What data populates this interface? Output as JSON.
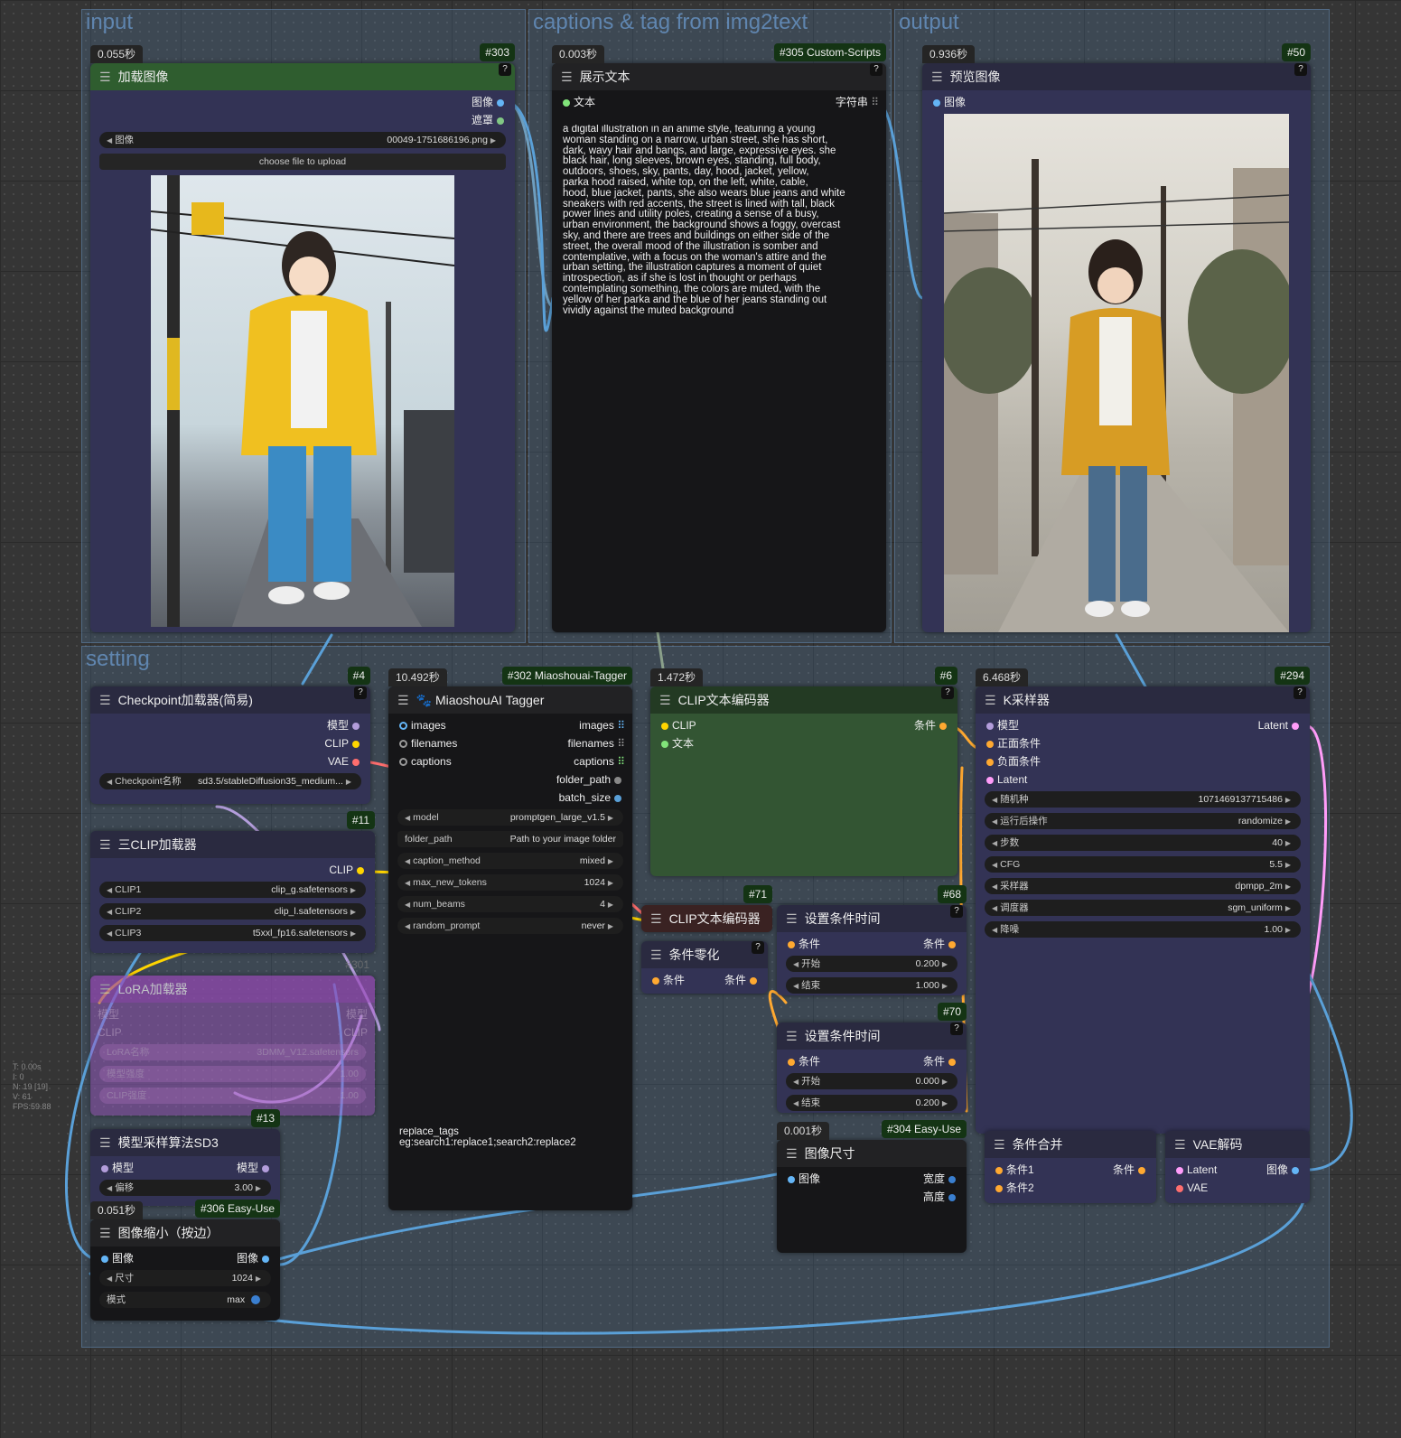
{
  "groups": {
    "input": "input",
    "captions": "captions & tag from img2text",
    "output": "output",
    "setting": "setting"
  },
  "nodes": {
    "load_image": {
      "time": "0.055秒",
      "id": "#303",
      "title": "加载图像",
      "outputs": [
        "图像",
        "遮罩"
      ],
      "image_widget_label": "图像",
      "image_widget_value": "00049-1751686196.png",
      "upload_label": "choose file to upload"
    },
    "show_text": {
      "time": "0.003秒",
      "id": "#305 Custom-Scripts",
      "title": "展示文本",
      "input": "文本",
      "output": "字符串",
      "lines": [
        "a digital illustration in an anime style, featuring a young",
        "woman standing on a narrow, urban street, she has short,",
        "dark, wavy hair and bangs, and large, expressive eyes. she",
        "black hair, long sleeves, brown eyes, standing, full body,",
        "outdoors, shoes, sky, pants, day, hood, jacket, yellow,",
        "parka hood raised, white top, on the left, white, cable,",
        "hood, blue jacket, pants, she also wears blue jeans and white",
        "sneakers with red accents, the street is lined with tall, black",
        "power lines and utility poles, creating a sense of a busy,",
        "urban environment, the background shows a foggy, overcast",
        "sky, and there are trees and buildings on either side of the",
        "street, the overall mood of the illustration is somber and",
        "contemplative, with a focus on the woman's attire and the",
        "urban setting, the illustration captures a moment of quiet",
        "introspection, as if she is lost in thought or perhaps",
        "contemplating something, the colors are muted, with the",
        "yellow of her parka and the blue of her jeans standing out",
        "vividly against the muted background"
      ]
    },
    "preview": {
      "time": "0.936秒",
      "id": "#50",
      "title": "预览图像",
      "input": "图像"
    },
    "checkpoint": {
      "id": "#4",
      "title": "Checkpoint加载器(简易)",
      "outputs": [
        "模型",
        "CLIP",
        "VAE"
      ],
      "widget_label": "Checkpoint名称",
      "widget_value": "sd3.5/stableDiffusion35_medium..."
    },
    "triple_clip": {
      "id": "#11",
      "title": "三CLIP加载器",
      "output": "CLIP",
      "widgets": [
        {
          "label": "CLIP1",
          "value": "clip_g.safetensors"
        },
        {
          "label": "CLIP2",
          "value": "clip_l.safetensors"
        },
        {
          "label": "CLIP3",
          "value": "t5xxl_fp16.safetensors"
        }
      ]
    },
    "lora": {
      "id": "#301",
      "title": "LoRA加载器",
      "inputs": [
        "模型",
        "CLIP"
      ],
      "outputs": [
        "模型",
        "CLIP"
      ],
      "widgets": [
        {
          "label": "LoRA名称",
          "value": "3DMM_V12.safetensors"
        },
        {
          "label": "模型强度",
          "value": "1.00"
        },
        {
          "label": "CLIP强度",
          "value": "1.00"
        }
      ]
    },
    "sd3_sampling": {
      "id": "#13",
      "title": "模型采样算法SD3",
      "input": "模型",
      "output": "模型",
      "widget_label": "偏移",
      "widget_value": "3.00"
    },
    "resize": {
      "time": "0.051秒",
      "id": "#306 Easy-Use",
      "title": "图像缩小（按边）",
      "input": "图像",
      "output": "图像",
      "widgets": [
        {
          "label": "尺寸",
          "value": "1024"
        },
        {
          "label": "模式",
          "value": "max"
        }
      ]
    },
    "tagger": {
      "time": "10.492秒",
      "id": "#302 Miaoshouai-Tagger",
      "title": "MiaoshouAI Tagger",
      "inputs": [
        "images",
        "filenames",
        "captions"
      ],
      "outputs": [
        "images",
        "filenames",
        "captions",
        "folder_path",
        "batch_size"
      ],
      "widgets": [
        {
          "label": "model",
          "value": "promptgen_large_v1.5"
        },
        {
          "label": "folder_path",
          "value": "Path to your image folder"
        },
        {
          "label": "caption_method",
          "value": "mixed"
        },
        {
          "label": "max_new_tokens",
          "value": "1024"
        },
        {
          "label": "num_beams",
          "value": "4"
        },
        {
          "label": "random_prompt",
          "value": "never"
        }
      ],
      "replace_label": "replace_tags",
      "replace_value": "eg:search1:replace1;search2:replace2"
    },
    "clip_encode": {
      "time": "1.472秒",
      "id": "#6",
      "title": "CLIP文本编码器",
      "inputs": [
        "CLIP",
        "文本"
      ],
      "output": "条件"
    },
    "clip_encode2": {
      "id": "#71",
      "title": "CLIP文本编码器"
    },
    "cond_zero": {
      "title": "条件零化",
      "input": "条件",
      "output": "条件"
    },
    "cond_time1": {
      "id": "#68",
      "title": "设置条件时间",
      "input": "条件",
      "output": "条件",
      "widgets": [
        {
          "label": "开始",
          "value": "0.200"
        },
        {
          "label": "结束",
          "value": "1.000"
        }
      ]
    },
    "cond_time2": {
      "id": "#70",
      "title": "设置条件时间",
      "input": "条件",
      "output": "条件",
      "widgets": [
        {
          "label": "开始",
          "value": "0.000"
        },
        {
          "label": "结束",
          "value": "0.200"
        }
      ]
    },
    "image_size": {
      "time": "0.001秒",
      "id": "#304 Easy-Use",
      "title": "图像尺寸",
      "input": "图像",
      "outputs": [
        "宽度",
        "高度"
      ]
    },
    "ksampler": {
      "time": "6.468秒",
      "id": "#294",
      "title": "K采样器",
      "inputs": [
        "模型",
        "正面条件",
        "负面条件",
        "Latent"
      ],
      "output": "Latent",
      "widgets": [
        {
          "label": "随机种",
          "value": "1071469137715486"
        },
        {
          "label": "运行后操作",
          "value": "randomize"
        },
        {
          "label": "步数",
          "value": "40"
        },
        {
          "label": "CFG",
          "value": "5.5"
        },
        {
          "label": "采样器",
          "value": "dpmpp_2m"
        },
        {
          "label": "调度器",
          "value": "sgm_uniform"
        },
        {
          "label": "降噪",
          "value": "1.00"
        }
      ]
    },
    "cond_combine": {
      "title": "条件合并",
      "inputs": [
        "条件1",
        "条件2"
      ],
      "output": "条件"
    },
    "vae_decode": {
      "title": "VAE解码",
      "inputs": [
        "Latent",
        "VAE"
      ],
      "output": "图像"
    }
  },
  "stats": [
    "T: 0.00s",
    "I: 0",
    "N: 19 [19]",
    "V: 61",
    "FPS:59.88"
  ],
  "colors": {
    "accent_id_bg": "#143414",
    "node_bg": "#333355",
    "group_bg": "#5a8cbe",
    "wire_image": "#64b5f6",
    "wire_clip": "#ffd500",
    "wire_vae": "#ff6e6e",
    "wire_cond": "#ffa931",
    "wire_latent": "#ff9cf9",
    "wire_model": "#b39ddb"
  },
  "icons": {
    "menu": "hamburger-icon",
    "help": "question-icon",
    "arrow": "triangle-arrow-icon"
  }
}
